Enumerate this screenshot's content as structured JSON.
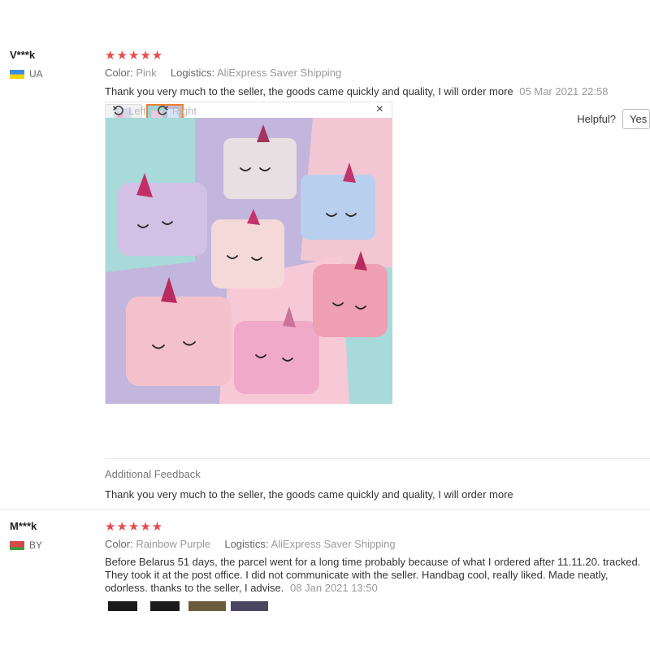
{
  "reviews": [
    {
      "user": "V***k",
      "country": "UA",
      "stars": "★★★★★",
      "color_key": "Color:",
      "color_val": "Pink",
      "logistics_key": "Logistics:",
      "logistics_val": "AliExpress Saver Shipping",
      "text": "Thank you very much to the seller, the goods came quickly and quality, I will order more",
      "date": "05 Mar 2021 22:58",
      "helpful_label": "Helpful?",
      "yes_label": "Yes (",
      "viewer": {
        "left": "Left",
        "right": "Right",
        "close": "×"
      },
      "additional_title": "Additional Feedback",
      "additional_text": "Thank you very much to the seller, the goods came quickly and quality, I will order more"
    },
    {
      "user": "M***k",
      "country": "BY",
      "stars": "★★★★★",
      "color_key": "Color:",
      "color_val": "Rainbow Purple",
      "logistics_key": "Logistics:",
      "logistics_val": "AliExpress Saver Shipping",
      "text": "Before Belarus 51 days, the parcel went for a long time probably because of what I ordered after 11.11.20. tracked. They took it at the post office. I did not communicate with the seller. Handbag cool, really liked. Made neatly, odorless. thanks to the seller, I advise.",
      "date": "08 Jan 2021 13:50"
    }
  ],
  "colors": {
    "star": "#e84b4b",
    "selected_border": "#f08030"
  },
  "icons": [
    "rotate-left-icon",
    "rotate-right-icon",
    "close-icon"
  ]
}
